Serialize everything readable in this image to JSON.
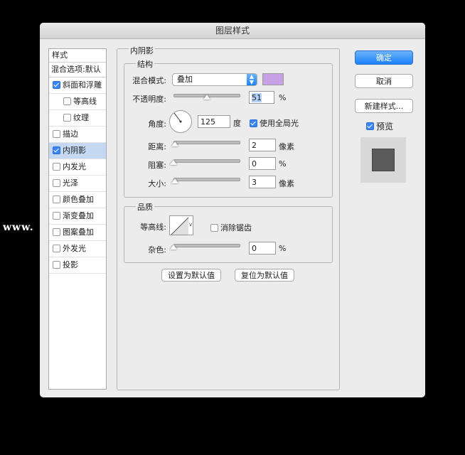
{
  "window": {
    "title": "图层样式"
  },
  "sidebar": {
    "header": "样式",
    "blend_options": "混合选项:默认",
    "items": [
      {
        "label": "斜面和浮雕",
        "checked": true,
        "sub": false,
        "selected": false
      },
      {
        "label": "等高线",
        "checked": false,
        "sub": true,
        "selected": false
      },
      {
        "label": "纹理",
        "checked": false,
        "sub": true,
        "selected": false
      },
      {
        "label": "描边",
        "checked": false,
        "sub": false,
        "selected": false
      },
      {
        "label": "内阴影",
        "checked": true,
        "sub": false,
        "selected": true
      },
      {
        "label": "内发光",
        "checked": false,
        "sub": false,
        "selected": false
      },
      {
        "label": "光泽",
        "checked": false,
        "sub": false,
        "selected": false
      },
      {
        "label": "颜色叠加",
        "checked": false,
        "sub": false,
        "selected": false
      },
      {
        "label": "渐变叠加",
        "checked": false,
        "sub": false,
        "selected": false
      },
      {
        "label": "图案叠加",
        "checked": false,
        "sub": false,
        "selected": false
      },
      {
        "label": "外发光",
        "checked": false,
        "sub": false,
        "selected": false
      },
      {
        "label": "投影",
        "checked": false,
        "sub": false,
        "selected": false
      }
    ]
  },
  "panel": {
    "title": "内阴影",
    "structure": {
      "title": "结构",
      "blend_mode_label": "混合模式:",
      "blend_mode_value": "叠加",
      "color": "#c7a1e6",
      "opacity_label": "不透明度:",
      "opacity_value": "51",
      "opacity_unit": "%",
      "opacity_fraction": 0.51,
      "angle_label": "角度:",
      "angle_value": "125",
      "angle_unit": "度",
      "global_light_label": "使用全局光",
      "global_light_checked": true,
      "distance_label": "距离:",
      "distance_value": "2",
      "distance_unit": "像素",
      "choke_label": "阻塞:",
      "choke_value": "0",
      "choke_unit": "%",
      "size_label": "大小:",
      "size_value": "3",
      "size_unit": "像素"
    },
    "quality": {
      "title": "品质",
      "contour_label": "等高线:",
      "antialias_label": "消除锯齿",
      "antialias_checked": false,
      "noise_label": "杂色:",
      "noise_value": "0",
      "noise_unit": "%"
    },
    "make_default": "设置为默认值",
    "reset_default": "复位为默认值"
  },
  "buttons": {
    "ok": "确定",
    "cancel": "取消",
    "new_style": "新建样式...",
    "preview_label": "预览",
    "preview_checked": true
  },
  "watermark": "www."
}
